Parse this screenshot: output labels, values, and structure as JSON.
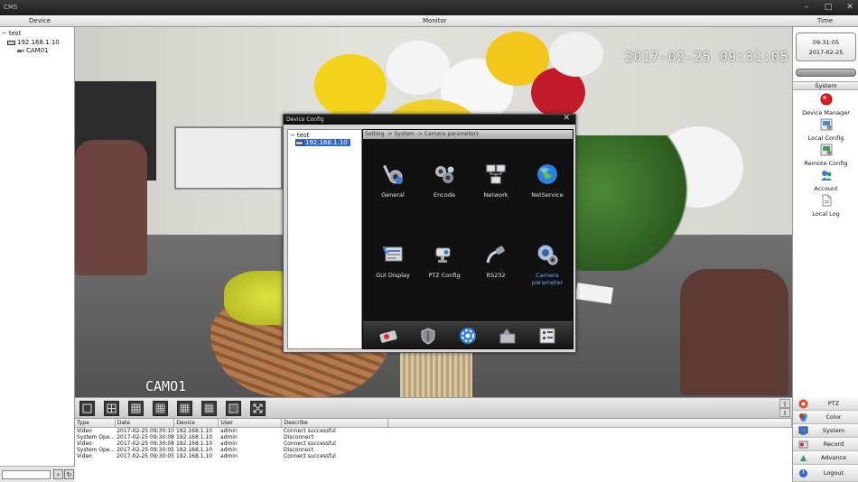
{
  "window": {
    "title": "CMS"
  },
  "header": {
    "device": "Device",
    "monitor": "Monitor",
    "time": "Time"
  },
  "device_tree": {
    "group": "test",
    "ip": "192.168.1.10",
    "camera": "CAM01"
  },
  "video": {
    "timestamp": "2017-02-25 09:31:05",
    "camera_label": "CAMO1"
  },
  "dialog": {
    "title": "Device Config",
    "tree_group": "test",
    "tree_ip": "192.168.1.10",
    "breadcrumb": "Setting -> System -> Camera parameters",
    "items": [
      {
        "label": "General",
        "icon": "general-gears-icon"
      },
      {
        "label": "Encode",
        "icon": "encode-gears-icon"
      },
      {
        "label": "Network",
        "icon": "network-icon"
      },
      {
        "label": "NetService",
        "icon": "globe-icon"
      },
      {
        "label": "GUI Display",
        "icon": "gui-display-icon"
      },
      {
        "label": "PTZ Config",
        "icon": "ptz-camera-icon"
      },
      {
        "label": "RS232",
        "icon": "rs232-cable-icon"
      },
      {
        "label": "Camera parameter",
        "icon": "camera-parameter-icon"
      }
    ]
  },
  "right_panel": {
    "clock_time": "09:31:05",
    "clock_date": "2017-02-25",
    "section": "System",
    "items": [
      {
        "label": "Device Manager",
        "icon": "record-dot-icon"
      },
      {
        "label": "Local Config",
        "icon": "local-config-icon"
      },
      {
        "label": "Remote Config",
        "icon": "remote-config-icon"
      },
      {
        "label": "Account",
        "icon": "account-icon"
      },
      {
        "label": "Local Log",
        "icon": "local-log-icon"
      }
    ]
  },
  "controls": [
    {
      "label": "PTZ",
      "icon": "ptz-icon"
    },
    {
      "label": "Color",
      "icon": "color-icon"
    },
    {
      "label": "System",
      "icon": "system-icon"
    },
    {
      "label": "Record",
      "icon": "record-icon"
    },
    {
      "label": "Advance",
      "icon": "advance-icon"
    },
    {
      "label": "Logout",
      "icon": "logout-icon"
    }
  ],
  "log": {
    "headers": [
      "Type",
      "Date",
      "Device",
      "User",
      "Describe"
    ],
    "rows": [
      [
        "Video",
        "2017-02-25 09:30:10",
        "192.168.1.10",
        "admin",
        "Connect successful"
      ],
      [
        "System Ope...",
        "2017-02-25 09:30:08",
        "192.168.1.10",
        "admin",
        "Disconnect"
      ],
      [
        "Video",
        "2017-02-25 09:30:08",
        "192.168.1.10",
        "admin",
        "Connect successful"
      ],
      [
        "System Ope...",
        "2017-02-25 09:30:05",
        "192.168.1.10",
        "admin",
        "Disconnect"
      ],
      [
        "Video",
        "2017-02-25 09:30:05",
        "192.168.1.10",
        "admin",
        "Connect successful"
      ]
    ]
  },
  "colors": {
    "accent": "#4d8fff",
    "record_red": "#e02020",
    "dialog_dark": "#111111"
  }
}
